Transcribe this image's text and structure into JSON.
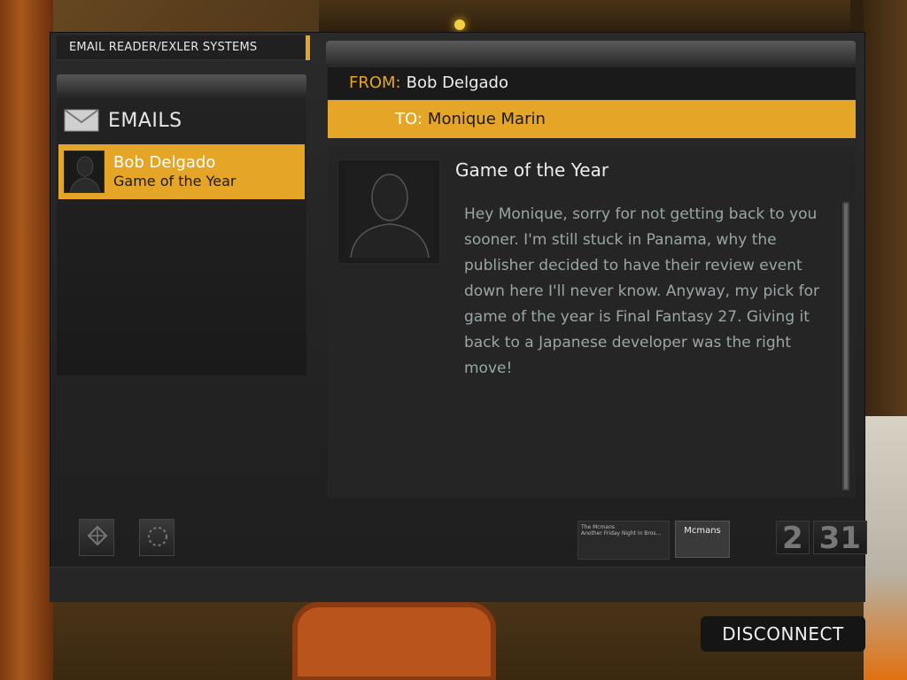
{
  "system": {
    "title": "EMAIL READER/EXLER SYSTEMS"
  },
  "inbox": {
    "header": "EMAILS",
    "items": [
      {
        "sender": "Bob Delgado",
        "subject": "Game of the Year",
        "selected": true
      }
    ]
  },
  "message": {
    "from_label": "FROM:",
    "from": "Bob Delgado",
    "to_label": "TO:",
    "to": "Monique Marin",
    "subject": "Game of the Year",
    "body": "Hey Monique, sorry for not getting back to you sooner. I'm still stuck in Panama, why the publisher decided to have their review event down here I'll never know. Anyway, my pick for game of the year is Final Fantasy 27. Giving it back to a Japanese developer was the right move!"
  },
  "widgets": {
    "news_title": "The Mcmans",
    "news_headline": "Another Friday Night in Bros...",
    "news_thumb_label": "Mcmans",
    "clock": {
      "hour": "2",
      "minute": "31"
    }
  },
  "actions": {
    "disconnect_label": "DISCONNECT"
  },
  "colors": {
    "accent": "#e5a526",
    "panel": "#1e1e1e",
    "body_text": "#9aa6a6"
  }
}
